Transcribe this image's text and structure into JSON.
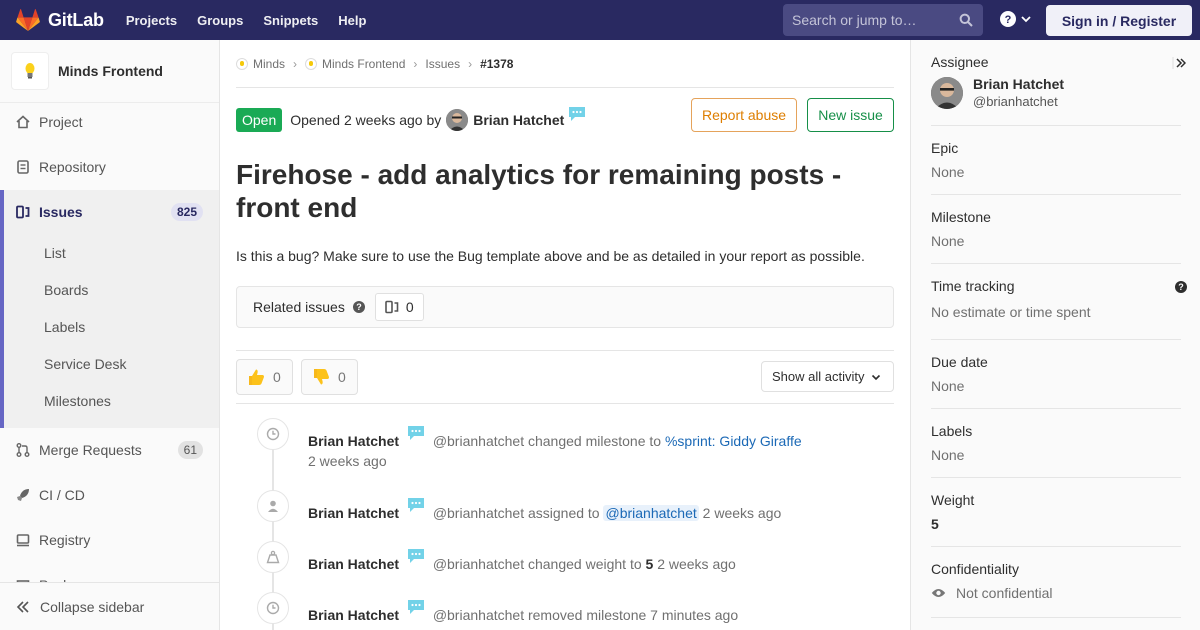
{
  "navbar": {
    "brand": "GitLab",
    "links": [
      "Projects",
      "Groups",
      "Snippets",
      "Help"
    ],
    "search_placeholder": "Search or jump to…",
    "signin_label": "Sign in / Register",
    "colors": {
      "bg": "#292961",
      "accent": "#fc6d26"
    }
  },
  "sidebar": {
    "project_name": "Minds Frontend",
    "items": [
      {
        "label": "Project",
        "icon": "home-icon"
      },
      {
        "label": "Repository",
        "icon": "doc-icon"
      },
      {
        "label": "Issues",
        "icon": "issues-icon",
        "badge": "825",
        "active": true
      },
      {
        "label": "Merge Requests",
        "icon": "merge-request-icon",
        "badge": "61"
      },
      {
        "label": "CI / CD",
        "icon": "rocket-icon"
      },
      {
        "label": "Registry",
        "icon": "registry-icon"
      },
      {
        "label": "Packages",
        "icon": "package-icon"
      }
    ],
    "issues_sub": [
      "List",
      "Boards",
      "Labels",
      "Service Desk",
      "Milestones"
    ],
    "collapse_label": "Collapse sidebar"
  },
  "breadcrumb": [
    "Minds",
    "Minds Frontend",
    "Issues",
    "#1378"
  ],
  "issue": {
    "status": "Open",
    "opened_text": "Opened 2 weeks ago by",
    "author": "Brian Hatchet",
    "report_label": "Report abuse",
    "new_issue_label": "New issue",
    "title": "Firehose - add analytics for remaining posts - front end",
    "description": "Is this a bug? Make sure to use the Bug template above and be as detailed in your report as possible.",
    "related_label": "Related issues",
    "related_count": "0",
    "thumbs_up": "0",
    "thumbs_down": "0",
    "activity_filter": "Show all activity"
  },
  "timeline": [
    {
      "icon": "clock-icon",
      "author": "Brian Hatchet",
      "handle": "@brianhatchet",
      "action": "changed milestone to",
      "link": "%sprint: Giddy Giraffe",
      "time": "2 weeks ago"
    },
    {
      "icon": "user-icon",
      "author": "Brian Hatchet",
      "handle": "@brianhatchet",
      "action": "assigned to",
      "mention": "@brianhatchet",
      "time": "2 weeks ago"
    },
    {
      "icon": "weight-icon",
      "author": "Brian Hatchet",
      "handle": "@brianhatchet",
      "action": "changed weight to",
      "value": "5",
      "time": "2 weeks ago"
    },
    {
      "icon": "clock-icon",
      "author": "Brian Hatchet",
      "handle": "@brianhatchet",
      "action": "removed milestone",
      "time": "7 minutes ago"
    }
  ],
  "right_sidebar": {
    "assignee_label": "Assignee",
    "assignee_name": "Brian Hatchet",
    "assignee_handle": "@brianhatchet",
    "epic_label": "Epic",
    "epic_value": "None",
    "milestone_label": "Milestone",
    "milestone_value": "None",
    "time_label": "Time tracking",
    "time_value": "No estimate or time spent",
    "due_label": "Due date",
    "due_value": "None",
    "labels_label": "Labels",
    "labels_value": "None",
    "weight_label": "Weight",
    "weight_value": "5",
    "conf_label": "Confidentiality",
    "conf_value": "Not confidential"
  }
}
